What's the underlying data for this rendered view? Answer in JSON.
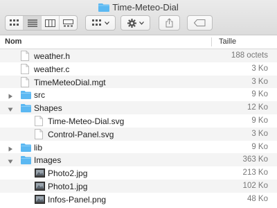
{
  "window": {
    "title": "Time-Meteo-Dial"
  },
  "toolbar": {
    "view_modes": [
      "icon-view",
      "list-view",
      "column-view",
      "gallery-view"
    ],
    "active_view": "list-view",
    "arrange_icon": "arrange-grid-icon",
    "action_icon": "gear-icon",
    "share_icon": "share-icon",
    "tag_icon": "tag-icon"
  },
  "columns": {
    "name": "Nom",
    "size": "Taille"
  },
  "files": [
    {
      "name": "weather.h",
      "size": "188 octets",
      "kind": "file",
      "depth": 0,
      "disclosure": "none"
    },
    {
      "name": "weather.c",
      "size": "3 Ko",
      "kind": "file",
      "depth": 0,
      "disclosure": "none"
    },
    {
      "name": "TimeMeteoDial.mgt",
      "size": "3 Ko",
      "kind": "file",
      "depth": 0,
      "disclosure": "none"
    },
    {
      "name": "src",
      "size": "9 Ko",
      "kind": "folder",
      "depth": 0,
      "disclosure": "collapsed"
    },
    {
      "name": "Shapes",
      "size": "12 Ko",
      "kind": "folder",
      "depth": 0,
      "disclosure": "expanded"
    },
    {
      "name": "Time-Meteo-Dial.svg",
      "size": "9 Ko",
      "kind": "file",
      "depth": 1,
      "disclosure": "none"
    },
    {
      "name": "Control-Panel.svg",
      "size": "3 Ko",
      "kind": "file",
      "depth": 1,
      "disclosure": "none"
    },
    {
      "name": "lib",
      "size": "9 Ko",
      "kind": "folder",
      "depth": 0,
      "disclosure": "collapsed"
    },
    {
      "name": "Images",
      "size": "363 Ko",
      "kind": "folder",
      "depth": 0,
      "disclosure": "expanded"
    },
    {
      "name": "Photo2.jpg",
      "size": "213 Ko",
      "kind": "image",
      "depth": 1,
      "disclosure": "none"
    },
    {
      "name": "Photo1.jpg",
      "size": "102 Ko",
      "kind": "image",
      "depth": 1,
      "disclosure": "none"
    },
    {
      "name": "Infos-Panel.png",
      "size": "48 Ko",
      "kind": "image",
      "depth": 1,
      "disclosure": "none"
    }
  ],
  "colors": {
    "folder": "#5bb8f2",
    "folder_tab": "#8fd0f7",
    "stripe": "#f4f4f4"
  }
}
